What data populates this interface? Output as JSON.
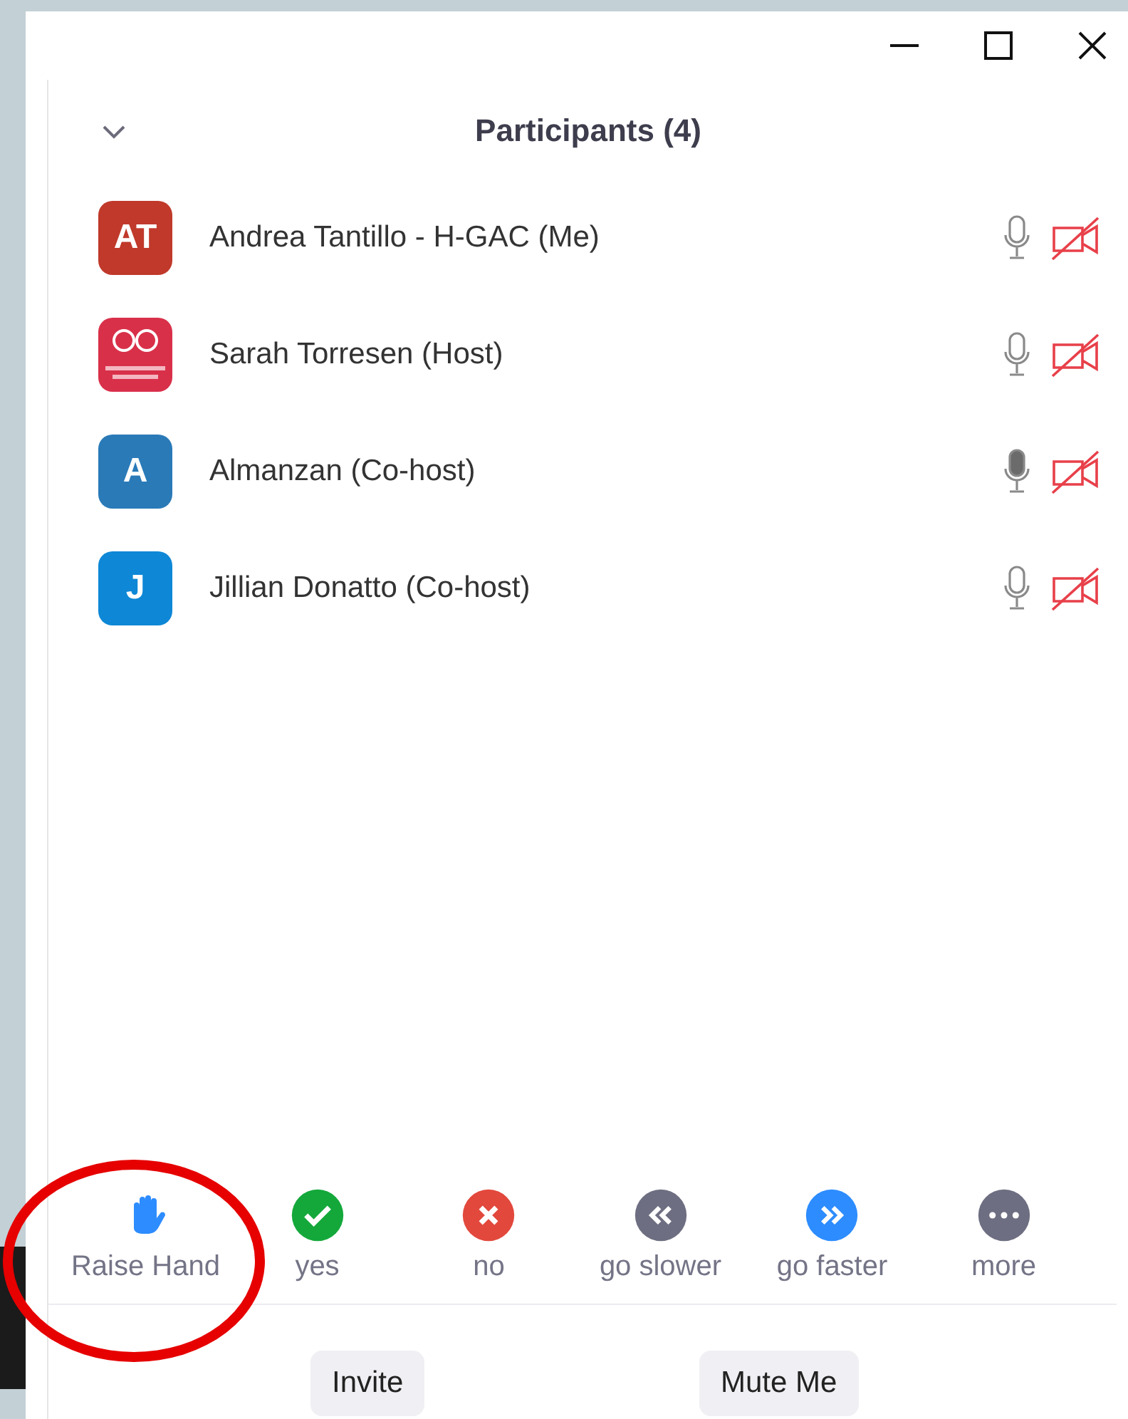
{
  "panel": {
    "title": "Participants (4)"
  },
  "participants": [
    {
      "name": "Andrea Tantillo - H-GAC (Me)",
      "avatar": {
        "kind": "initials",
        "text": "AT",
        "color": "#c0392b"
      },
      "mic_active": false,
      "video_off": true
    },
    {
      "name": "Sarah Torresen (Host)",
      "mic_active": false,
      "video_off": true
    },
    {
      "name": "Almanzan (Co-host)",
      "avatar": {
        "kind": "initials",
        "text": "A",
        "color": "#2a7ab8"
      },
      "mic_active": true,
      "video_off": true
    },
    {
      "name": "Jillian Donatto (Co-host)",
      "avatar": {
        "kind": "initials",
        "text": "J",
        "color": "#0e87d6"
      },
      "mic_active": false,
      "video_off": true
    }
  ],
  "reactions": [
    {
      "kind": "hand",
      "label": "Raise Hand",
      "circled": true
    },
    {
      "kind": "yes",
      "label": "yes",
      "circled": false
    },
    {
      "kind": "no",
      "label": "no",
      "circled": false
    },
    {
      "kind": "slower",
      "label": "go slower",
      "circled": false
    },
    {
      "kind": "faster",
      "label": "go faster",
      "circled": false
    },
    {
      "kind": "more",
      "label": "more",
      "circled": false
    }
  ],
  "buttons": [
    "Invite",
    "Mute Me"
  ]
}
